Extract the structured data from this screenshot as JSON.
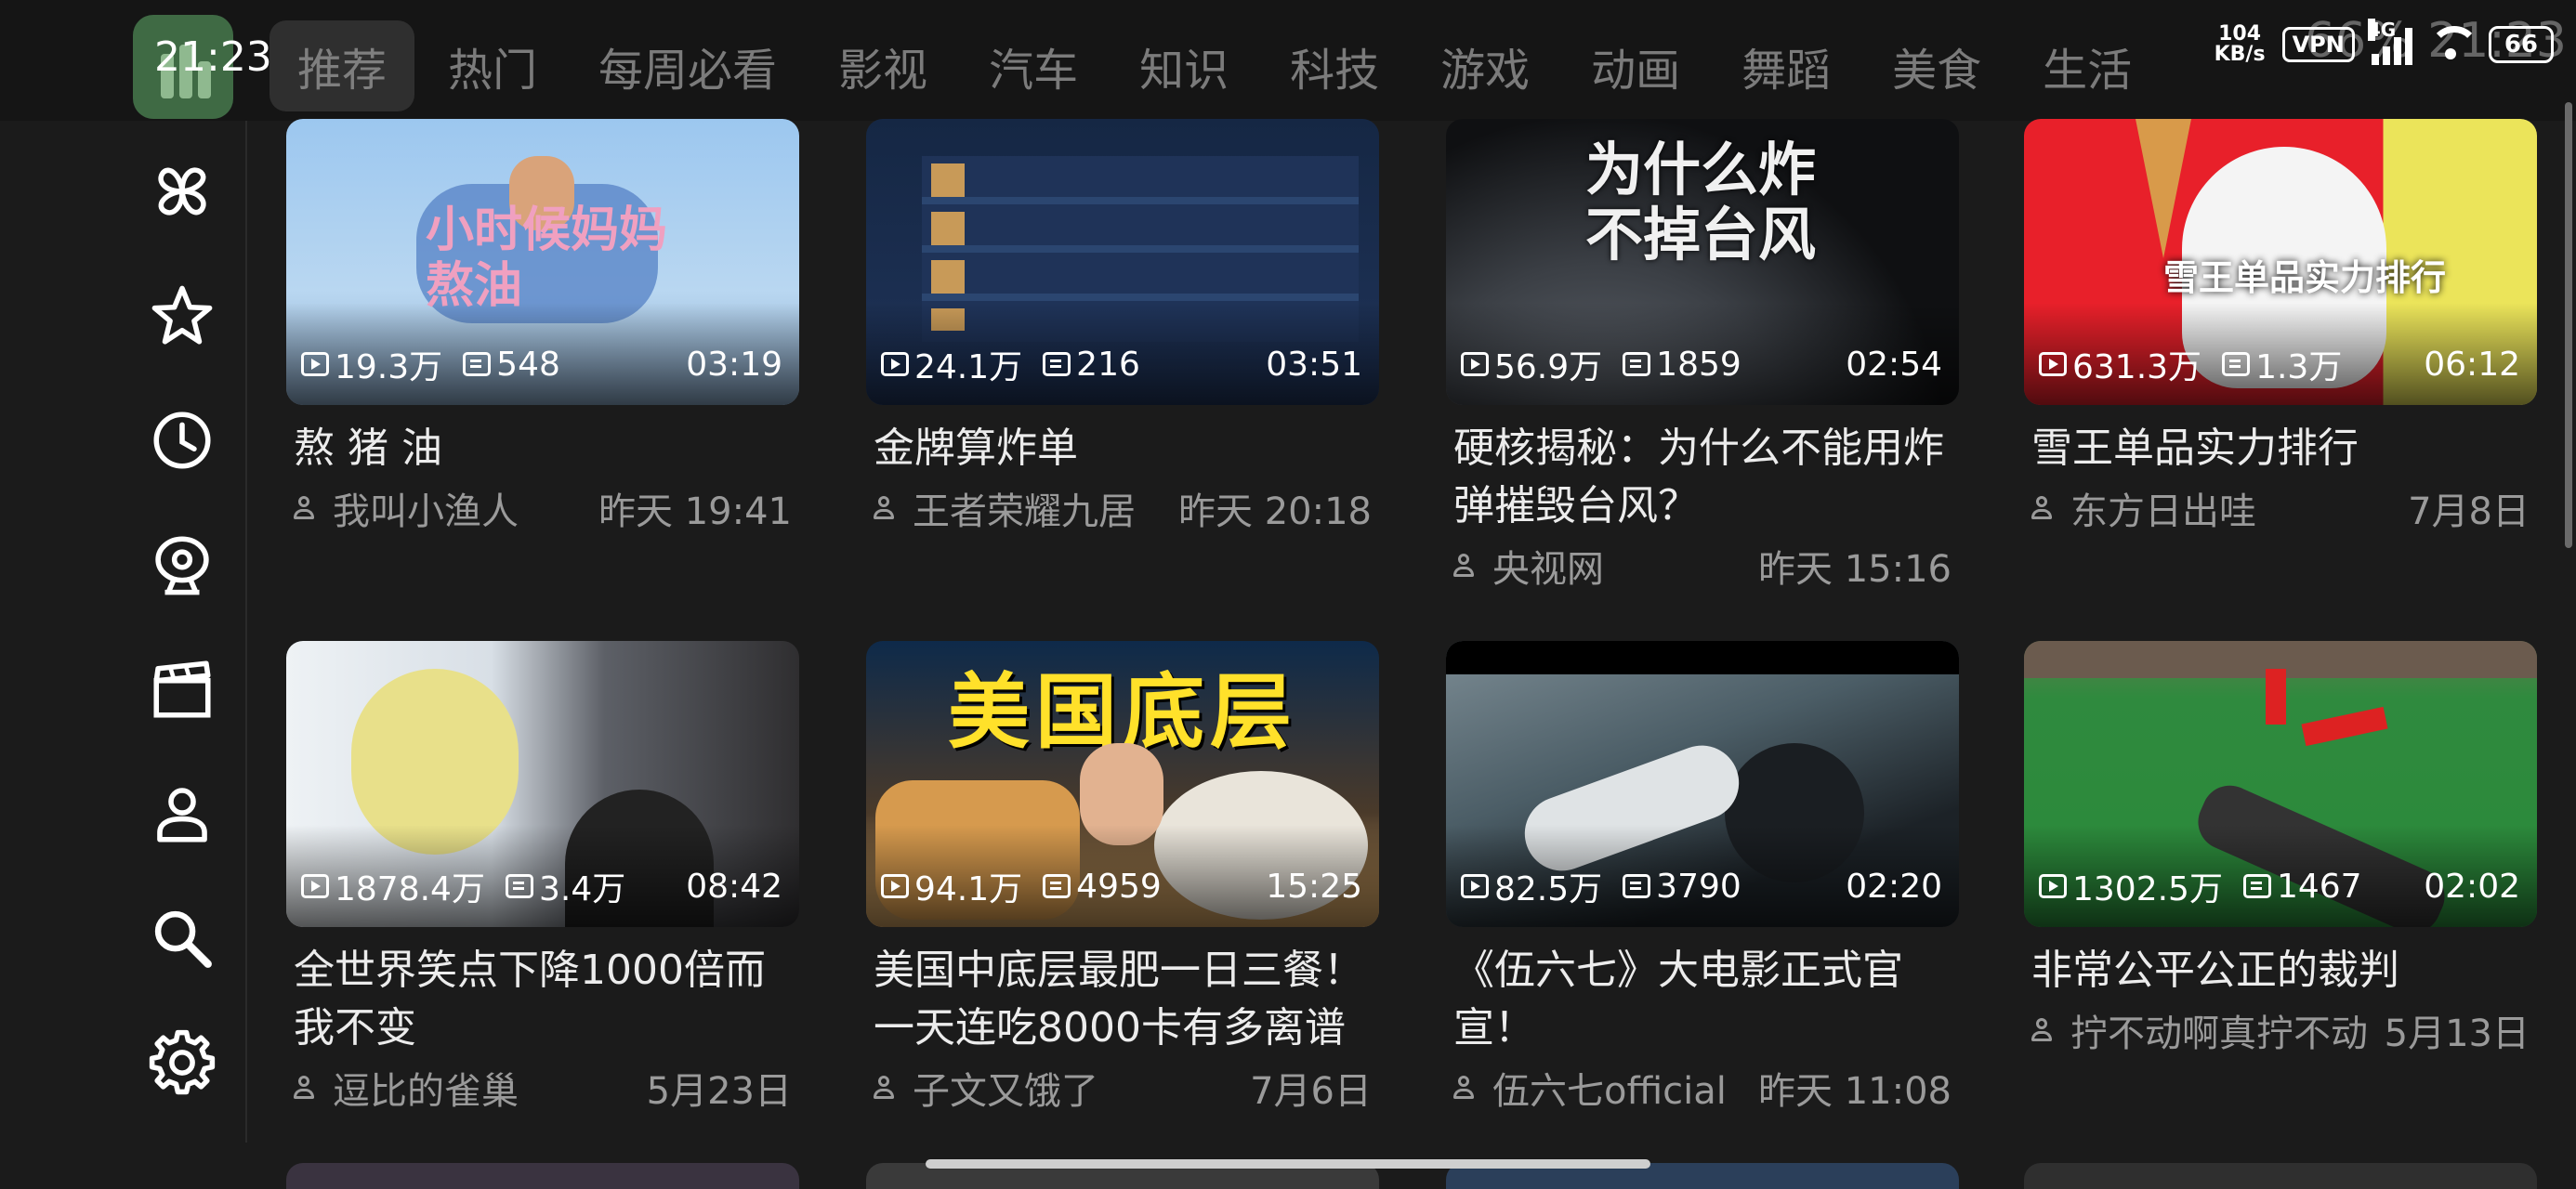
{
  "status_bar": {
    "time_left": "21:23",
    "net_speed_value": "104",
    "net_speed_unit": "KB/s",
    "vpn": "VPN",
    "signal": "4G",
    "battery": "66",
    "overlay_text": "66% 21:23"
  },
  "tabs": [
    {
      "label": "推荐"
    },
    {
      "label": "热门"
    },
    {
      "label": "每周必看"
    },
    {
      "label": "影视"
    },
    {
      "label": "汽车"
    },
    {
      "label": "知识"
    },
    {
      "label": "科技"
    },
    {
      "label": "游戏"
    },
    {
      "label": "动画"
    },
    {
      "label": "舞蹈"
    },
    {
      "label": "美食"
    },
    {
      "label": "生活"
    }
  ],
  "sidebar": [
    {
      "icon": "pinwheel-icon"
    },
    {
      "icon": "star-icon"
    },
    {
      "icon": "clock-icon"
    },
    {
      "icon": "webcam-icon"
    },
    {
      "icon": "clapperboard-icon"
    },
    {
      "icon": "user-icon"
    },
    {
      "icon": "search-icon"
    },
    {
      "icon": "gear-icon"
    }
  ],
  "videos": [
    {
      "views": "19.3万",
      "danmaku": "548",
      "duration": "03:19",
      "title": "熬 猪 油",
      "author": "我叫小渔人",
      "time": "昨天 19:41",
      "thumb_text": "小时候妈妈熬油"
    },
    {
      "views": "24.1万",
      "danmaku": "216",
      "duration": "03:51",
      "title": "金牌算炸单",
      "author": "王者荣耀九居",
      "time": "昨天 20:18",
      "thumb_text": ""
    },
    {
      "views": "56.9万",
      "danmaku": "1859",
      "duration": "02:54",
      "title": "硬核揭秘：为什么不能用炸弹摧毁台风？",
      "author": "央视网",
      "time": "昨天 15:16",
      "thumb_text": "为什么炸不掉台风"
    },
    {
      "views": "631.3万",
      "danmaku": "1.3万",
      "duration": "06:12",
      "title": "雪王单品实力排行",
      "author": "东方日出哇",
      "time": "7月8日",
      "thumb_text": "雪王单品实力排行"
    },
    {
      "views": "1878.4万",
      "danmaku": "3.4万",
      "duration": "08:42",
      "title": "全世界笑点下降1000倍而我不变",
      "author": "逗比的雀巢",
      "time": "5月23日",
      "thumb_text": ""
    },
    {
      "views": "94.1万",
      "danmaku": "4959",
      "duration": "15:25",
      "title": "美国中底层最肥一日三餐！一天连吃8000卡有多离谱",
      "author": "子文又饿了",
      "time": "7月6日",
      "thumb_text": "美国底层"
    },
    {
      "views": "82.5万",
      "danmaku": "3790",
      "duration": "02:20",
      "title": "《伍六七》大电影正式官宣！",
      "author": "伍六七official",
      "time": "昨天 11:08",
      "thumb_text": ""
    },
    {
      "views": "1302.5万",
      "danmaku": "1467",
      "duration": "02:02",
      "title": "非常公平公正的裁判",
      "author": "拧不动啊真拧不动",
      "time": "5月13日",
      "thumb_text": ""
    }
  ]
}
